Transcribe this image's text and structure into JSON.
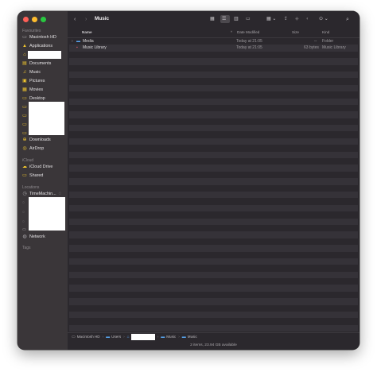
{
  "window": {
    "title": "Music"
  },
  "sidebar": {
    "sections": {
      "favourites": "Favourites",
      "icloud": "iCloud",
      "locations": "Locations",
      "tags": "Tags"
    },
    "favourites": [
      {
        "label": "Macintosh HD",
        "icon": "disk-icon"
      },
      {
        "label": "Applications",
        "icon": "applications-icon"
      },
      {
        "label": "",
        "icon": "home-icon"
      },
      {
        "label": "Documents",
        "icon": "documents-icon"
      },
      {
        "label": "Music",
        "icon": "music-icon"
      },
      {
        "label": "Pictures",
        "icon": "pictures-icon"
      },
      {
        "label": "Movies",
        "icon": "movies-icon"
      },
      {
        "label": "Desktop",
        "icon": "desktop-icon"
      },
      {
        "label": "Downloads",
        "icon": "downloads-icon"
      },
      {
        "label": "AirDrop",
        "icon": "airdrop-icon"
      }
    ],
    "icloud": [
      {
        "label": "iCloud Drive",
        "icon": "cloud-icon"
      },
      {
        "label": "Shared",
        "icon": "shared-folder-icon"
      }
    ],
    "locations": [
      {
        "label": "TimeMachin...",
        "icon": "time-machine-icon"
      },
      {
        "label": "Network",
        "icon": "network-icon"
      }
    ]
  },
  "columns": {
    "name": "Name",
    "date": "Date Modified",
    "size": "Size",
    "kind": "Kind"
  },
  "files": [
    {
      "name": "Media",
      "date": "Today at 21:05",
      "size": "--",
      "kind": "Folder",
      "icon": "folder-icon"
    },
    {
      "name": "Music Library",
      "date": "Today at 21:05",
      "size": "63 bytes",
      "kind": "Music Library",
      "icon": "music-library-icon"
    }
  ],
  "pathbar": [
    "Macintosh HD",
    "Users",
    "",
    "Music",
    "Music"
  ],
  "status": "2 items, 23.94 GB available",
  "colors": {
    "sidebar": "#3a3639",
    "content": "#2b282d",
    "stripe": "#353238",
    "folder": "#5aa9f5",
    "favourite_icon": "#f0c52e"
  }
}
